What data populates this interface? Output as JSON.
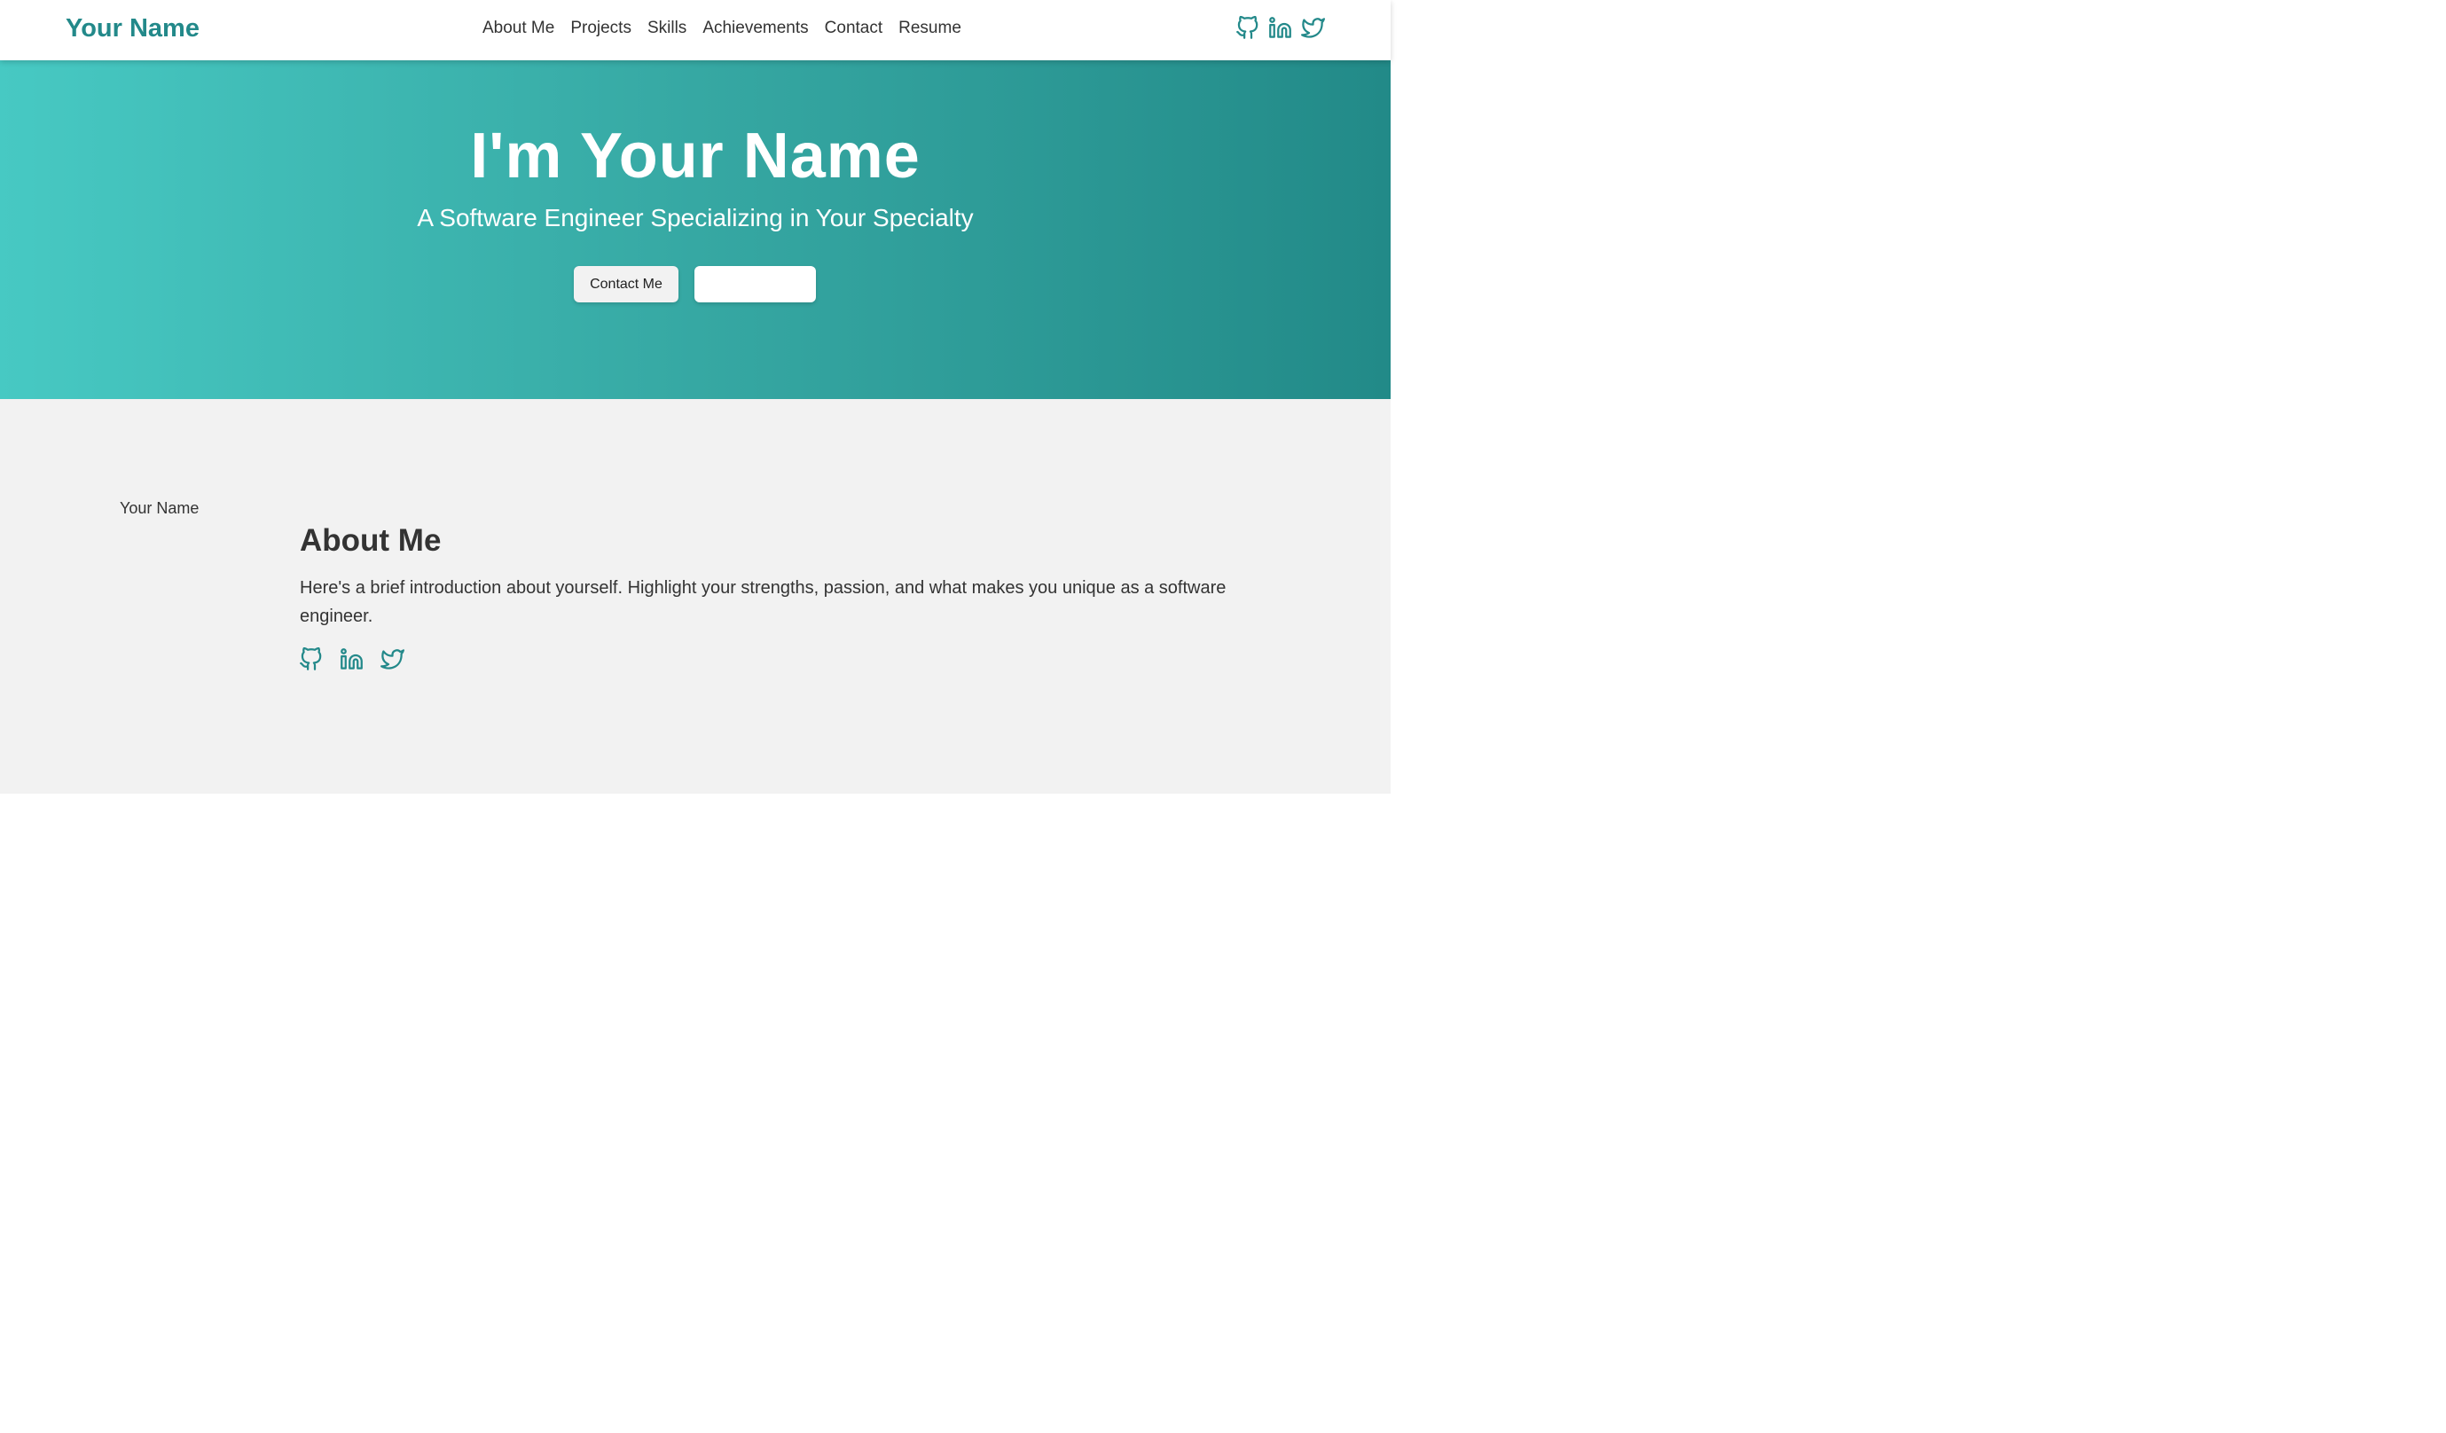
{
  "colors": {
    "accent": "#23898a",
    "hero_gradient_start": "#47c9c3",
    "hero_gradient_end": "#228a88",
    "section_bg": "#f2f2f2",
    "text": "#333333"
  },
  "header": {
    "brand": "Your Name",
    "nav": [
      {
        "label": "About Me"
      },
      {
        "label": "Projects"
      },
      {
        "label": "Skills"
      },
      {
        "label": "Achievements"
      },
      {
        "label": "Contact"
      },
      {
        "label": "Resume"
      }
    ],
    "social_icons": [
      "github-icon",
      "linkedin-icon",
      "twitter-icon"
    ]
  },
  "hero": {
    "title": "I'm Your Name",
    "subtitle": "A Software Engineer Specializing in Your Specialty",
    "contact_button": "Contact Me",
    "resume_button": ""
  },
  "about": {
    "image_alt": "Your Name",
    "title": "About Me",
    "text": "Here's a brief introduction about yourself. Highlight your strengths, passion, and what makes you unique as a software engineer.",
    "social_icons": [
      "github-icon",
      "linkedin-icon",
      "twitter-icon"
    ]
  }
}
